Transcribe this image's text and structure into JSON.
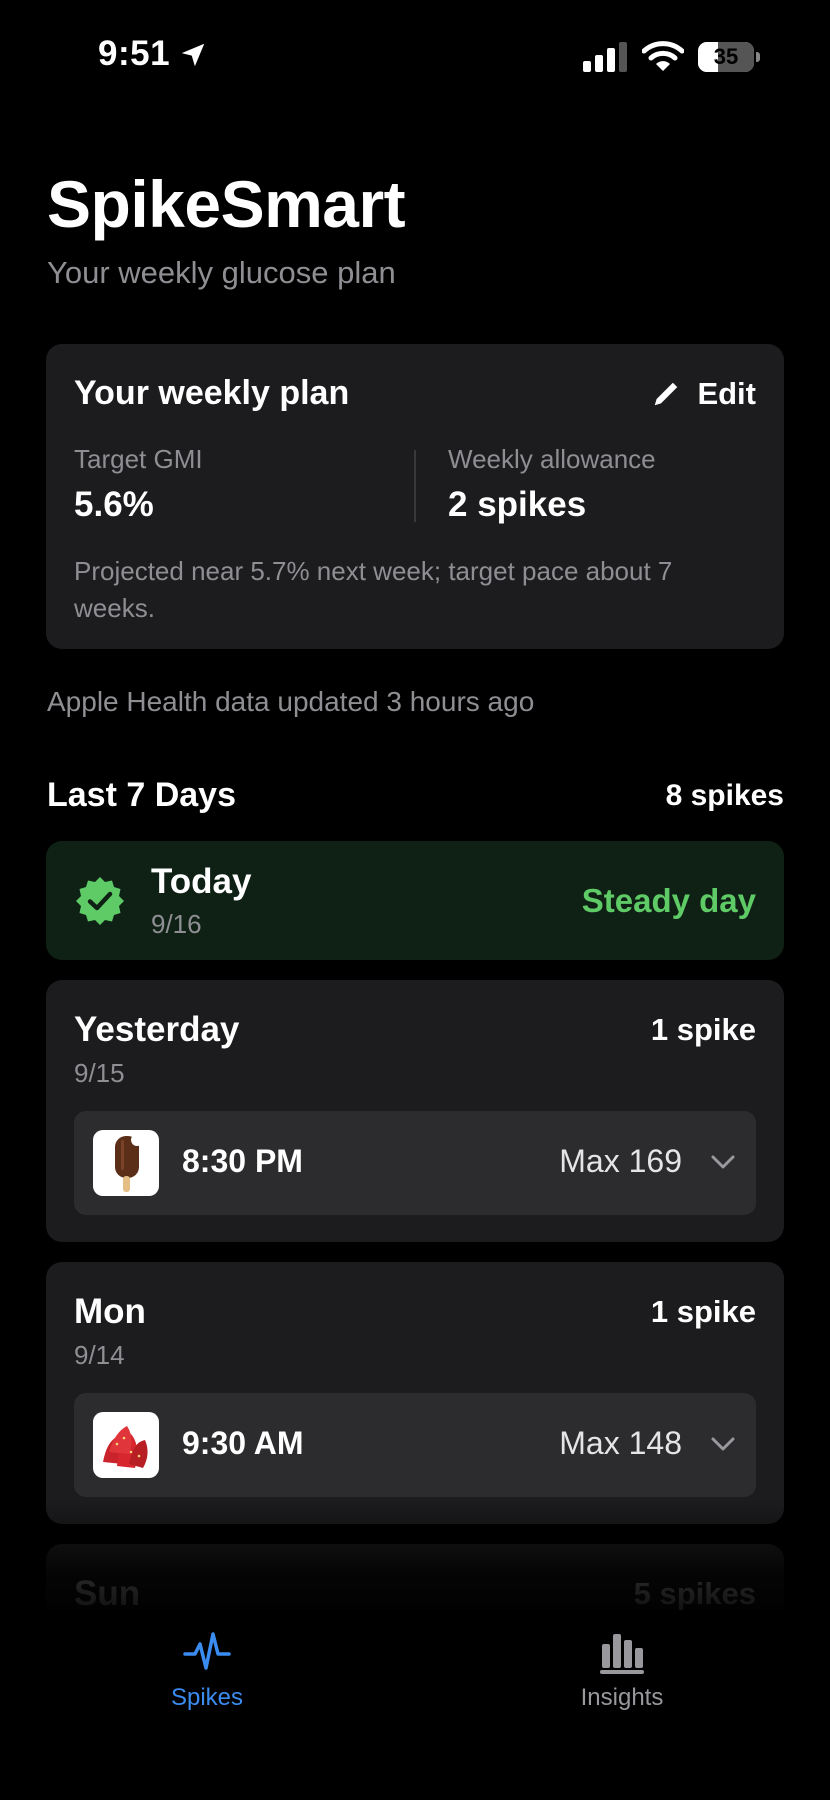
{
  "status_bar": {
    "time": "9:51",
    "battery": "35",
    "battery_level": 0.35
  },
  "header": {
    "title": "SpikeSmart",
    "subtitle": "Your weekly glucose plan"
  },
  "plan": {
    "title": "Your weekly plan",
    "edit_label": "Edit",
    "target_label": "Target GMI",
    "target_value": "5.6%",
    "allowance_label": "Weekly allowance",
    "allowance_value": "2 spikes",
    "note": "Projected near 5.7% next week; target pace about 7 weeks."
  },
  "health_note": "Apple Health data updated 3 hours ago",
  "section": {
    "title": "Last 7 Days",
    "count": "8 spikes"
  },
  "days": [
    {
      "name": "Today",
      "date": "9/16",
      "status": "Steady day"
    },
    {
      "name": "Yesterday",
      "date": "9/15",
      "count": "1 spike",
      "spikes": [
        {
          "time": "8:30 PM",
          "max": "Max 169",
          "icon": "ice-cream-bar-icon"
        }
      ]
    },
    {
      "name": "Mon",
      "date": "9/14",
      "count": "1 spike",
      "spikes": [
        {
          "time": "9:30 AM",
          "max": "Max 148",
          "icon": "strawberries-icon"
        }
      ]
    },
    {
      "name": "Sun",
      "count": "5 spikes"
    }
  ],
  "tabs": [
    {
      "label": "Spikes",
      "icon": "pulse-icon",
      "active": true
    },
    {
      "label": "Insights",
      "icon": "bar-chart-icon",
      "active": false
    }
  ],
  "colors": {
    "accent": "#3b8cf0",
    "success": "#5fcb66",
    "card": "#1c1c1e",
    "row": "#2c2c2e"
  }
}
